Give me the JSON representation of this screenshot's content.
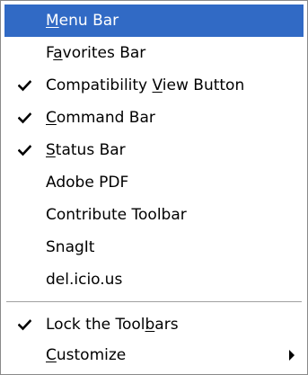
{
  "menu": {
    "items": [
      {
        "id": "menu-bar",
        "pre": "",
        "key": "M",
        "post": "enu Bar",
        "checked": false,
        "highlighted": true,
        "submenu": false
      },
      {
        "id": "favorites-bar",
        "pre": "F",
        "key": "a",
        "post": "vorites Bar",
        "checked": false,
        "highlighted": false,
        "submenu": false
      },
      {
        "id": "compatibility-view-button",
        "pre": "Compatibility ",
        "key": "V",
        "post": "iew Button",
        "checked": true,
        "highlighted": false,
        "submenu": false
      },
      {
        "id": "command-bar",
        "pre": "",
        "key": "C",
        "post": "ommand Bar",
        "checked": true,
        "highlighted": false,
        "submenu": false
      },
      {
        "id": "status-bar",
        "pre": "",
        "key": "S",
        "post": "tatus Bar",
        "checked": true,
        "highlighted": false,
        "submenu": false
      },
      {
        "id": "adobe-pdf",
        "pre": "Adobe PDF",
        "key": "",
        "post": "",
        "checked": false,
        "highlighted": false,
        "submenu": false
      },
      {
        "id": "contribute-toolbar",
        "pre": "Contribute Toolbar",
        "key": "",
        "post": "",
        "checked": false,
        "highlighted": false,
        "submenu": false
      },
      {
        "id": "snagit",
        "pre": "SnagIt",
        "key": "",
        "post": "",
        "checked": false,
        "highlighted": false,
        "submenu": false
      },
      {
        "id": "del-icio-us",
        "pre": "del.icio.us",
        "key": "",
        "post": "",
        "checked": false,
        "highlighted": false,
        "submenu": false
      },
      {
        "id": "lock-the-toolbars",
        "pre": "Lock the Tool",
        "key": "b",
        "post": "ars",
        "checked": true,
        "highlighted": false,
        "submenu": false
      },
      {
        "id": "customize",
        "pre": "",
        "key": "C",
        "post": "ustomize",
        "checked": false,
        "highlighted": false,
        "submenu": true
      }
    ]
  },
  "icons": {
    "check": "checkmark-icon",
    "submenu": "submenu-arrow-icon"
  },
  "colors": {
    "highlight_bg": "#316ac5",
    "highlight_text": "#ffffff",
    "text": "#000000",
    "border": "#8a8a8a",
    "separator": "#a0a0a0"
  }
}
